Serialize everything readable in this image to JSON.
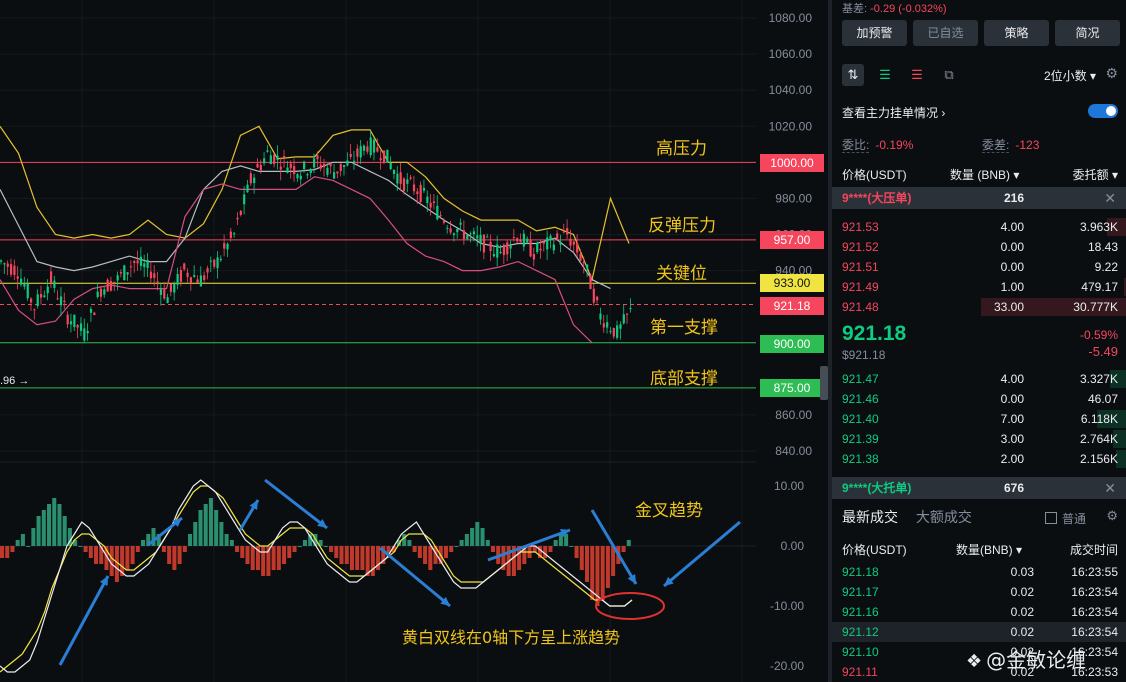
{
  "chart_data": [
    {
      "type": "candlestick",
      "title": "",
      "y_axis_ticks": [
        "1080.00",
        "1060.00",
        "1040.00",
        "1020.00",
        "980.00",
        "960.00",
        "940.00",
        "860.00",
        "840.00"
      ],
      "ylim": [
        832,
        1084
      ],
      "visible_low_label": ".96 →",
      "horizontal_levels": [
        {
          "value": 1000,
          "label": "1000.00",
          "color": "#f6465d",
          "annotation": "高压力"
        },
        {
          "value": 957,
          "label": "957.00",
          "color": "#f6465d",
          "annotation": "反弹压力"
        },
        {
          "value": 933,
          "label": "933.00",
          "color": "#f0e442",
          "annotation": "关键位"
        },
        {
          "value": 921.18,
          "label": "921.18",
          "color": "#f6465d",
          "annotation": ""
        },
        {
          "value": 900,
          "label": "900.00",
          "color": "#2ebd55",
          "annotation": "第一支撑"
        },
        {
          "value": 875,
          "label": "875.00",
          "color": "#2ebd55",
          "annotation": "底部支撑"
        }
      ],
      "close_trend": [
        [
          0,
          945
        ],
        [
          5,
          940
        ],
        [
          10,
          920
        ],
        [
          15,
          935
        ],
        [
          20,
          915
        ],
        [
          25,
          905
        ],
        [
          30,
          930
        ],
        [
          35,
          935
        ],
        [
          40,
          945
        ],
        [
          45,
          940
        ],
        [
          50,
          925
        ],
        [
          55,
          940
        ],
        [
          60,
          935
        ],
        [
          65,
          945
        ],
        [
          70,
          960
        ],
        [
          75,
          990
        ],
        [
          80,
          1005
        ],
        [
          85,
          1000
        ],
        [
          90,
          995
        ],
        [
          95,
          1000
        ],
        [
          100,
          995
        ],
        [
          105,
          1000
        ],
        [
          110,
          1010
        ],
        [
          115,
          1005
        ],
        [
          120,
          990
        ],
        [
          125,
          985
        ],
        [
          130,
          975
        ],
        [
          135,
          965
        ],
        [
          140,
          960
        ],
        [
          145,
          955
        ],
        [
          150,
          950
        ],
        [
          155,
          960
        ],
        [
          160,
          950
        ],
        [
          165,
          955
        ],
        [
          170,
          960
        ],
        [
          175,
          945
        ],
        [
          180,
          915
        ],
        [
          185,
          905
        ],
        [
          190,
          920
        ]
      ],
      "bollinger_upper": [
        [
          0,
          1020
        ],
        [
          5,
          1005
        ],
        [
          10,
          975
        ],
        [
          15,
          960
        ],
        [
          20,
          958
        ],
        [
          25,
          960
        ],
        [
          30,
          958
        ],
        [
          35,
          960
        ],
        [
          40,
          968
        ],
        [
          45,
          960
        ],
        [
          50,
          958
        ],
        [
          55,
          966
        ],
        [
          60,
          985
        ],
        [
          65,
          1015
        ],
        [
          70,
          1020
        ],
        [
          75,
          1002
        ],
        [
          80,
          1003
        ],
        [
          85,
          1003
        ],
        [
          90,
          1015
        ],
        [
          95,
          1018
        ],
        [
          100,
          1018
        ],
        [
          105,
          1000
        ],
        [
          110,
          1000
        ],
        [
          115,
          992
        ],
        [
          120,
          980
        ],
        [
          125,
          973
        ],
        [
          130,
          968
        ],
        [
          135,
          968
        ],
        [
          140,
          968
        ],
        [
          145,
          962
        ],
        [
          150,
          964
        ],
        [
          155,
          960
        ],
        [
          160,
          935
        ],
        [
          165,
          980
        ],
        [
          170,
          955
        ]
      ],
      "bollinger_mid": [
        [
          0,
          985
        ],
        [
          5,
          965
        ],
        [
          10,
          945
        ],
        [
          15,
          942
        ],
        [
          20,
          940
        ],
        [
          25,
          942
        ],
        [
          30,
          945
        ],
        [
          35,
          948
        ],
        [
          40,
          945
        ],
        [
          45,
          945
        ],
        [
          50,
          958
        ],
        [
          55,
          985
        ],
        [
          60,
          995
        ],
        [
          65,
          998
        ],
        [
          70,
          995
        ],
        [
          75,
          995
        ],
        [
          80,
          995
        ],
        [
          85,
          996
        ],
        [
          90,
          1000
        ],
        [
          95,
          1000
        ],
        [
          100,
          995
        ],
        [
          105,
          990
        ],
        [
          110,
          982
        ],
        [
          115,
          975
        ],
        [
          120,
          968
        ],
        [
          125,
          962
        ],
        [
          130,
          955
        ],
        [
          135,
          953
        ],
        [
          140,
          955
        ],
        [
          145,
          955
        ],
        [
          150,
          958
        ],
        [
          155,
          950
        ],
        [
          160,
          935
        ],
        [
          165,
          930
        ]
      ],
      "bollinger_lower": [
        [
          0,
          935
        ],
        [
          5,
          918
        ],
        [
          10,
          910
        ],
        [
          15,
          912
        ],
        [
          20,
          924
        ],
        [
          25,
          930
        ],
        [
          30,
          932
        ],
        [
          35,
          930
        ],
        [
          40,
          930
        ],
        [
          45,
          930
        ],
        [
          50,
          970
        ],
        [
          55,
          985
        ],
        [
          60,
          988
        ],
        [
          65,
          985
        ],
        [
          70,
          985
        ],
        [
          75,
          985
        ],
        [
          80,
          985
        ],
        [
          85,
          992
        ],
        [
          90,
          990
        ],
        [
          95,
          985
        ],
        [
          100,
          980
        ],
        [
          105,
          968
        ],
        [
          110,
          955
        ],
        [
          115,
          948
        ],
        [
          120,
          945
        ],
        [
          125,
          940
        ],
        [
          130,
          940
        ],
        [
          135,
          942
        ],
        [
          140,
          945
        ],
        [
          145,
          940
        ],
        [
          150,
          935
        ],
        [
          155,
          910
        ],
        [
          160,
          900
        ]
      ]
    },
    {
      "type": "macd",
      "title": "",
      "y_axis_ticks": [
        "10.00",
        "0.00",
        "-10.00",
        "-20.00"
      ],
      "ylim": [
        -21,
        11
      ],
      "histogram": [
        -2,
        -2,
        -1,
        1,
        2,
        0,
        3,
        5,
        6,
        7,
        8,
        7,
        5,
        3,
        1,
        0,
        -1,
        -2,
        -3,
        -3,
        -4,
        -5,
        -6,
        -5,
        -4,
        -3,
        -1,
        1,
        2,
        3,
        2,
        -1,
        -3,
        -4,
        -3,
        -1,
        2,
        4,
        6,
        7,
        8,
        6,
        4,
        2,
        1,
        -1,
        -2,
        -3,
        -4,
        -4,
        -5,
        -5,
        -4,
        -4,
        -3,
        -2,
        -1,
        0,
        1,
        2,
        2,
        1,
        0,
        -1,
        -2,
        -3,
        -3,
        -4,
        -4,
        -4,
        -5,
        -5,
        -4,
        -3,
        -2,
        -1,
        1,
        2,
        1,
        -1,
        -2,
        -3,
        -4,
        -3,
        -3,
        -2,
        -1,
        0,
        1,
        2,
        3,
        4,
        3,
        1,
        -1,
        -3,
        -4,
        -5,
        -5,
        -4,
        -3,
        -2,
        -1,
        -2,
        -2,
        -1,
        1,
        2,
        2,
        0,
        -2,
        -4,
        -6,
        -9,
        -10,
        -9,
        -7,
        -5,
        -3,
        -1,
        1
      ],
      "dif_line": [
        -20,
        -21,
        -21,
        -20,
        -19,
        -16,
        -12,
        -8,
        -4,
        0,
        2,
        4,
        3,
        1,
        -1,
        -3,
        -4,
        -5,
        -5,
        -4,
        -3,
        -1,
        1,
        3,
        6,
        8,
        10,
        11,
        10,
        9,
        7,
        5,
        3,
        1,
        0,
        -1,
        -1,
        1,
        3,
        4,
        4,
        3,
        1,
        -1,
        -3,
        -4,
        -5,
        -6,
        -6,
        -5,
        -4,
        -3,
        -2,
        0,
        2,
        3,
        4,
        2,
        0,
        -2,
        -4,
        -6,
        -7,
        -7,
        -7,
        -6,
        -5,
        -4,
        -3,
        -2,
        -1,
        0,
        0,
        -1,
        -2,
        -3,
        -4,
        -5,
        -6,
        -7,
        -8,
        -9,
        -10,
        -10,
        -10,
        -9
      ],
      "dea_line": [
        -21,
        -20,
        -19,
        -18,
        -16,
        -14,
        -11,
        -7,
        -4,
        -1,
        1,
        2,
        2,
        1,
        0,
        -2,
        -3,
        -4,
        -4,
        -3,
        -2,
        -1,
        1,
        3,
        5,
        7,
        9,
        10,
        10,
        9,
        8,
        6,
        4,
        2,
        1,
        0,
        0,
        1,
        2,
        3,
        3,
        3,
        2,
        0,
        -2,
        -3,
        -4,
        -5,
        -5,
        -5,
        -4,
        -3,
        -2,
        -1,
        1,
        2,
        2,
        2,
        1,
        -1,
        -3,
        -5,
        -6,
        -6,
        -6,
        -6,
        -5,
        -4,
        -3,
        -2,
        -1,
        -1,
        -1,
        -2,
        -3,
        -4,
        -5,
        -6,
        -7,
        -8,
        -9,
        -9,
        -10,
        -10,
        -10,
        -9
      ],
      "annotation_title": "金叉趋势",
      "annotation_note": "黄白双线在0轴下方呈上涨趋势"
    }
  ],
  "panel": {
    "top_strip_label": "基差:",
    "top_strip_value": "-0.29 (-0.032%)",
    "buttons": [
      "加预警",
      "已自选",
      "策略",
      "简况"
    ],
    "decimals": "2位小数",
    "main_orders_label": "查看主力挂单情况",
    "ratio_label": "委比:",
    "ratio_value": "-0.19%",
    "diff_label": "委差:",
    "diff_value": "-123",
    "headers": {
      "price": "价格(USDT)",
      "qty": "数量 (BNB)",
      "total": "委托额"
    },
    "big_ask": {
      "label": "9****(大压单)",
      "qty": "216"
    },
    "asks": [
      {
        "price": "921.53",
        "qty": "4.00",
        "total": "3.963K"
      },
      {
        "price": "921.52",
        "qty": "0.00",
        "total": "18.43"
      },
      {
        "price": "921.51",
        "qty": "0.00",
        "total": "9.22"
      },
      {
        "price": "921.49",
        "qty": "1.00",
        "total": "479.17"
      },
      {
        "price": "921.48",
        "qty": "33.00",
        "total": "30.777K"
      }
    ],
    "mid": {
      "price": "921.18",
      "sub": "$921.18",
      "pct": "-0.59%",
      "change": "-5.49"
    },
    "bids": [
      {
        "price": "921.47",
        "qty": "4.00",
        "total": "3.327K"
      },
      {
        "price": "921.46",
        "qty": "0.00",
        "total": "46.07"
      },
      {
        "price": "921.40",
        "qty": "7.00",
        "total": "6.118K"
      },
      {
        "price": "921.39",
        "qty": "3.00",
        "total": "2.764K"
      },
      {
        "price": "921.38",
        "qty": "2.00",
        "total": "2.156K"
      }
    ],
    "big_bid": {
      "label": "9****(大托单)",
      "qty": "676"
    },
    "trade_tabs": [
      "最新成交",
      "大额成交"
    ],
    "normal_label": "普通",
    "trade_headers": {
      "price": "价格(USDT)",
      "qty": "数量(BNB)",
      "time": "成交时间"
    },
    "trades": [
      {
        "price": "921.18",
        "qty": "0.03",
        "time": "16:23:55",
        "dir": "up"
      },
      {
        "price": "921.17",
        "qty": "0.02",
        "time": "16:23:54",
        "dir": "up"
      },
      {
        "price": "921.16",
        "qty": "0.02",
        "time": "16:23:54",
        "dir": "up"
      },
      {
        "price": "921.12",
        "qty": "0.02",
        "time": "16:23:54",
        "dir": "up"
      },
      {
        "price": "921.10",
        "qty": "0.02",
        "time": "16:23:54",
        "dir": "up"
      },
      {
        "price": "921.11",
        "qty": "0.02",
        "time": "16:23:53",
        "dir": "down"
      }
    ],
    "watermark": "@金敏论缠"
  },
  "colors": {
    "up": "#0ecb81",
    "down": "#f6465d",
    "yellow": "#f0c419",
    "bg": "#0b0e11"
  }
}
